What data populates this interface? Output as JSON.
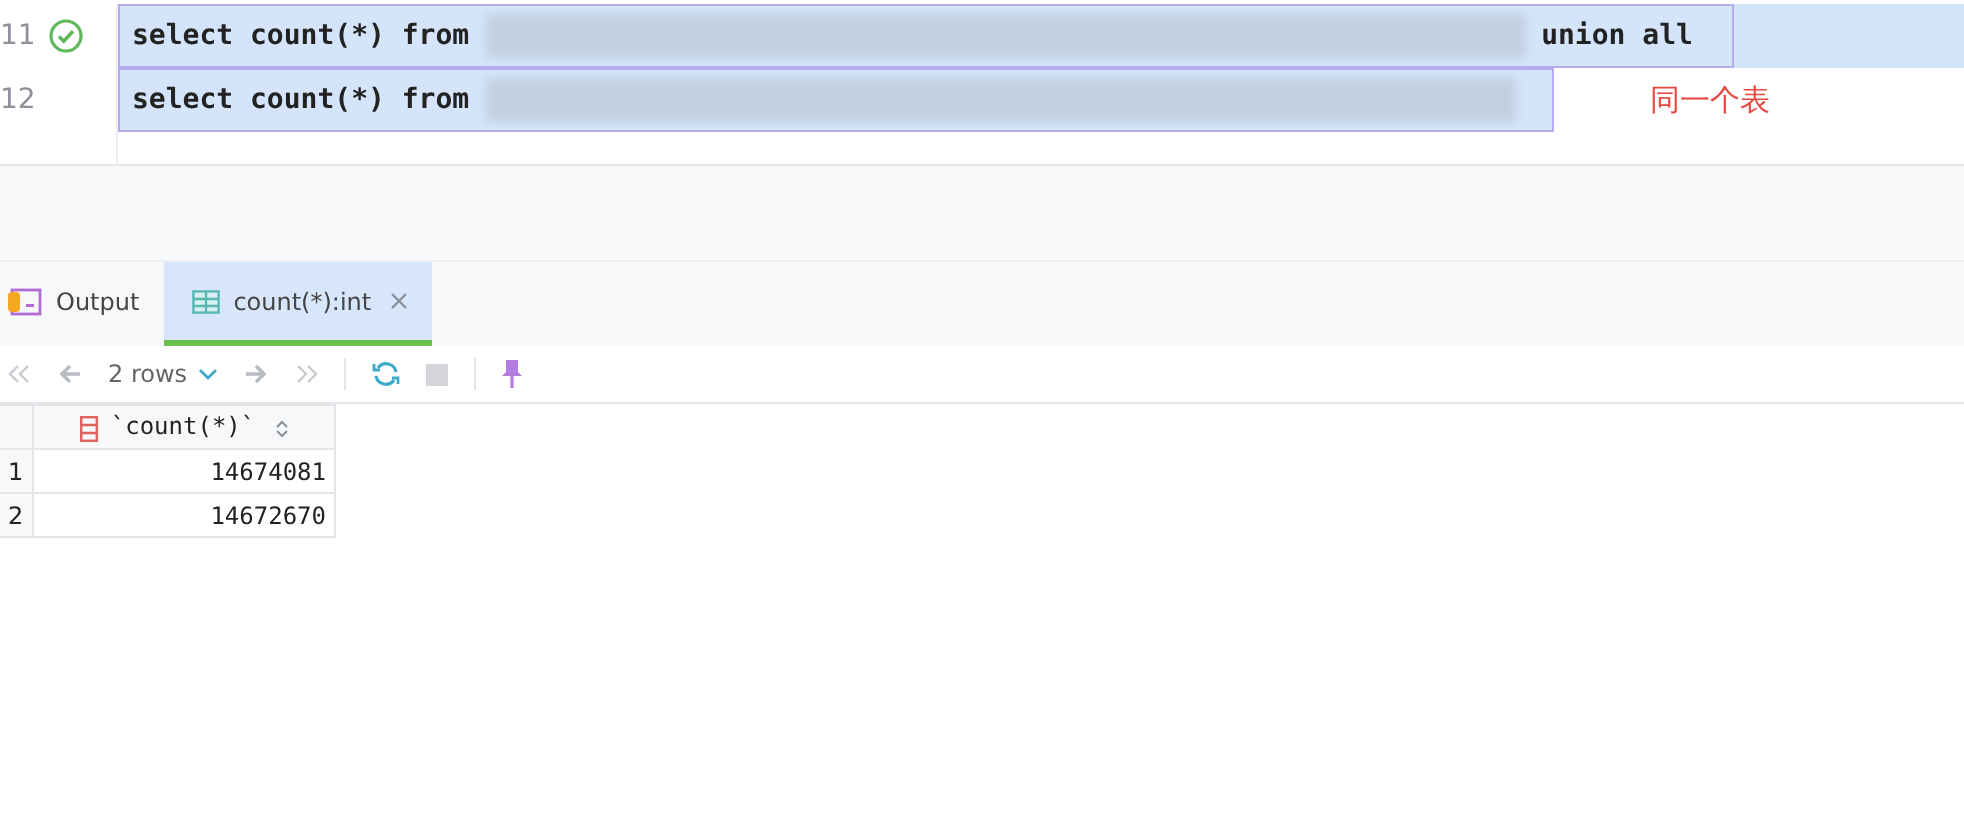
{
  "editor": {
    "lines": [
      {
        "number": "11",
        "status_ok": true,
        "current": true,
        "code_start": "select count(*) from",
        "code_end": "union all"
      },
      {
        "number": "12",
        "status_ok": false,
        "current": false,
        "code_start": "select count(*) from"
      }
    ],
    "annotation": "同一个表"
  },
  "results": {
    "tabs": [
      {
        "label": "Output",
        "selected": false,
        "kind": "output",
        "closable": false
      },
      {
        "label": "count(*):int",
        "selected": true,
        "kind": "table",
        "closable": true
      }
    ],
    "toolbar": {
      "rows_label": "2 rows"
    },
    "table": {
      "columns": [
        "`count(*)`"
      ],
      "rows": [
        {
          "number": "1",
          "cells": [
            "14674081"
          ]
        },
        {
          "number": "2",
          "cells": [
            "14672670"
          ]
        }
      ]
    }
  }
}
